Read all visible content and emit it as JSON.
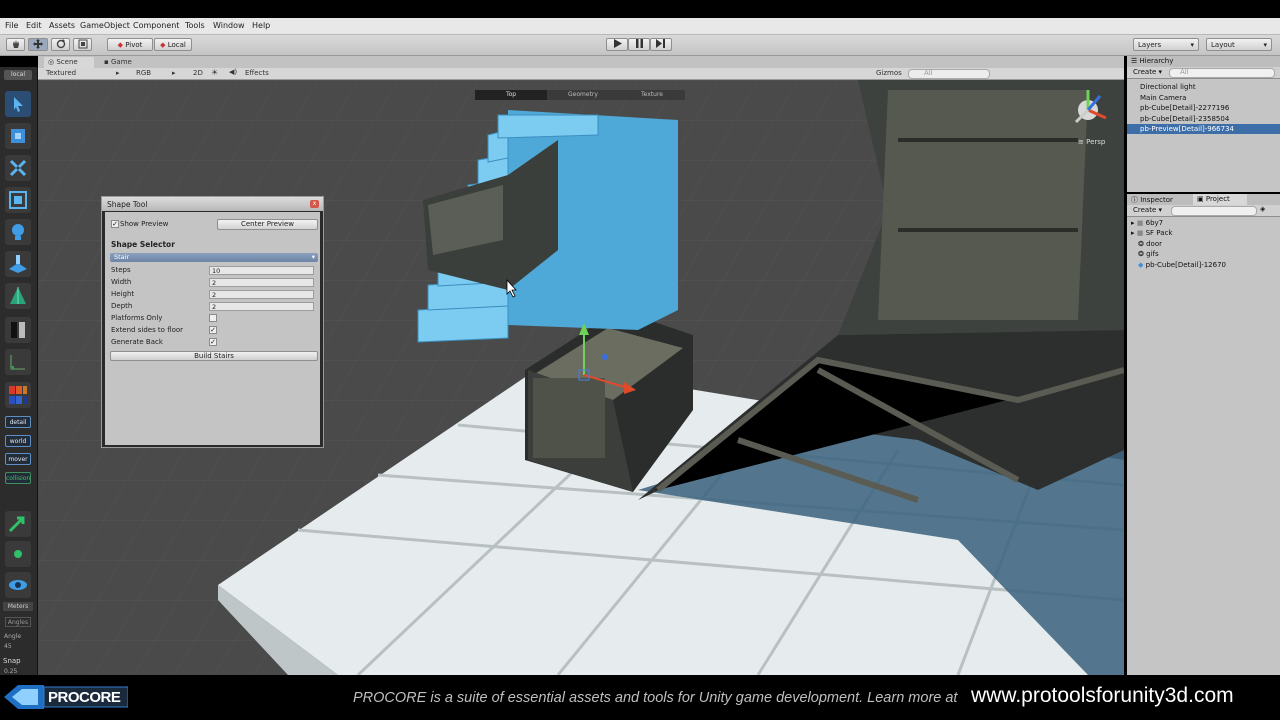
{
  "menu": [
    "File",
    "Edit",
    "Assets",
    "GameObject",
    "Component",
    "Tools",
    "Window",
    "Help"
  ],
  "toolbar": {
    "pivot_label": "Pivot",
    "local_label": "Local",
    "layers_label": "Layers",
    "layout_label": "Layout"
  },
  "scene": {
    "tab_scene": "Scene",
    "tab_game": "Game",
    "render_mode": "Textured",
    "color_mode": "RGB",
    "mode_2d": "2D",
    "effects_label": "Effects",
    "gizmos_label": "Gizmos",
    "search_placeholder": "All",
    "view_tabs": [
      "Top",
      "Geometry",
      "Texture"
    ],
    "persp_label": "Persp",
    "tool_local_label": "local"
  },
  "left_tools": {
    "labels": [
      "detail",
      "world",
      "mover",
      "collision"
    ],
    "meters_label": "Meters",
    "angles_label": "Angles",
    "angle_label": "Angle",
    "angle_value": "45",
    "snap_label": "Snap",
    "snap_value": "0.25"
  },
  "hierarchy": {
    "title": "Hierarchy",
    "create_label": "Create",
    "search_placeholder": "All",
    "items": [
      "Directional light",
      "Main Camera",
      "pb-Cube[Detail]-2277196",
      "pb-Cube[Detail]-2358504",
      "pb-Preview[Detail]-966734"
    ]
  },
  "project": {
    "tab_inspector": "Inspector",
    "tab_project": "Project",
    "create_label": "Create",
    "items": [
      "6by7",
      "SF Pack",
      "door",
      "gifs",
      "pb-Cube[Detail]-12670"
    ]
  },
  "shape_tool": {
    "title": "Shape Tool",
    "show_preview_label": "Show Preview",
    "show_preview_checked": "✓",
    "center_preview_label": "Center Preview",
    "section_title": "Shape Selector",
    "selected_shape": "Stair",
    "fields": [
      {
        "label": "Steps",
        "value": "10"
      },
      {
        "label": "Width",
        "value": "2"
      },
      {
        "label": "Height",
        "value": "2"
      },
      {
        "label": "Depth",
        "value": "2"
      }
    ],
    "toggles": [
      {
        "label": "Platforms Only",
        "mark": ""
      },
      {
        "label": "Extend sides to floor",
        "mark": "✓"
      },
      {
        "label": "Generate Back",
        "mark": "✓"
      }
    ],
    "build_label": "Build Stairs"
  },
  "banner": {
    "logo_text": "PROCORE",
    "tagline": "PROCORE is a suite of essential assets and tools for Unity game development. Learn more at",
    "url": "www.protoolsforunity3d.com"
  },
  "colors": {
    "stair_preview": "#5ab4e0",
    "grid_floor": "#e8eef0",
    "accent_blue": "#2f7fd0"
  }
}
